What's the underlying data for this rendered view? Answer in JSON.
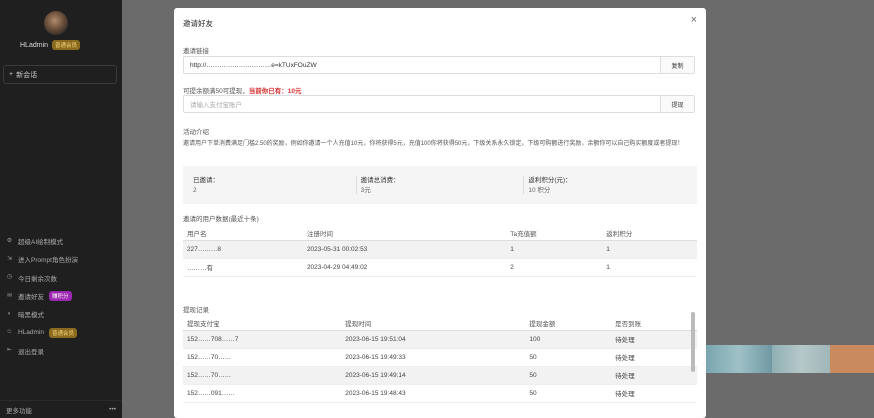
{
  "sidebar": {
    "username": "HLadmin",
    "username_badge": "普通会员",
    "new_chat": "新会话",
    "items": [
      {
        "icon": "⚙",
        "label": "超级AI绘制模式"
      },
      {
        "icon": "⇲",
        "label": "进入Prompt角色扮演"
      },
      {
        "icon": "◷",
        "label": "今日剩余次数"
      },
      {
        "icon": "✉",
        "label": "邀请好友",
        "badge": "赚积分"
      },
      {
        "icon": "◐",
        "label": "暗黑模式"
      },
      {
        "icon": "☺",
        "label": "HLadmin",
        "badge": "普通会员"
      },
      {
        "icon": "⇤",
        "label": "退出登录"
      }
    ],
    "footer_label": "更多功能",
    "footer_more": "•••"
  },
  "modal": {
    "title": "邀请好友",
    "close_icon": "×",
    "link_label": "邀请链接",
    "link_value": "http://…………………………e=kTUxFOuZW",
    "link_button": "复制",
    "withdraw_text": "可提余额满50可提现，",
    "withdraw_current": "当前你已有：10元",
    "alipay_placeholder": "请输入支付宝账户",
    "alipay_button": "提现",
    "intro_title": "活动介绍",
    "intro_text": "邀请用户下单消费满足门槛2.50的奖励，例如你邀请一个人充值10元，你将获得5元，充值100你将获得50元，下级关系永久锁定，下级可购额进行奖励，余额你可以自己购买额度或者提现！",
    "stats": [
      {
        "label": "已邀请：",
        "value": "2"
      },
      {
        "label": "邀请总消费：",
        "value": "3元"
      },
      {
        "label": "返利积分(元)：",
        "value": "10 积分"
      }
    ],
    "invited_title": "邀请的用户数据(最近十条)",
    "invited_headers": [
      "用户名",
      "注册时间",
      "Ta充值额",
      "返利积分"
    ],
    "invited_rows": [
      [
        "227………8",
        "2023-05-31 00:02:53",
        "1",
        "1"
      ],
      [
        "………有",
        "2023-04-29 04:49:02",
        "2",
        "1"
      ]
    ],
    "withdraw_title": "提现记录",
    "withdraw_headers": [
      "提现支付宝",
      "提现时间",
      "提现金额",
      "是否到账"
    ],
    "withdraw_rows": [
      [
        "152……708……7",
        "2023-06-15 19:51:04",
        "100",
        "待处理"
      ],
      [
        "152……70……",
        "2023-06-15 19:49:33",
        "50",
        "待处理"
      ],
      [
        "152……70……",
        "2023-06-15 19:49:14",
        "50",
        "待处理"
      ],
      [
        "152……091……",
        "2023-06-15 19:48:43",
        "50",
        "待处理"
      ]
    ]
  }
}
